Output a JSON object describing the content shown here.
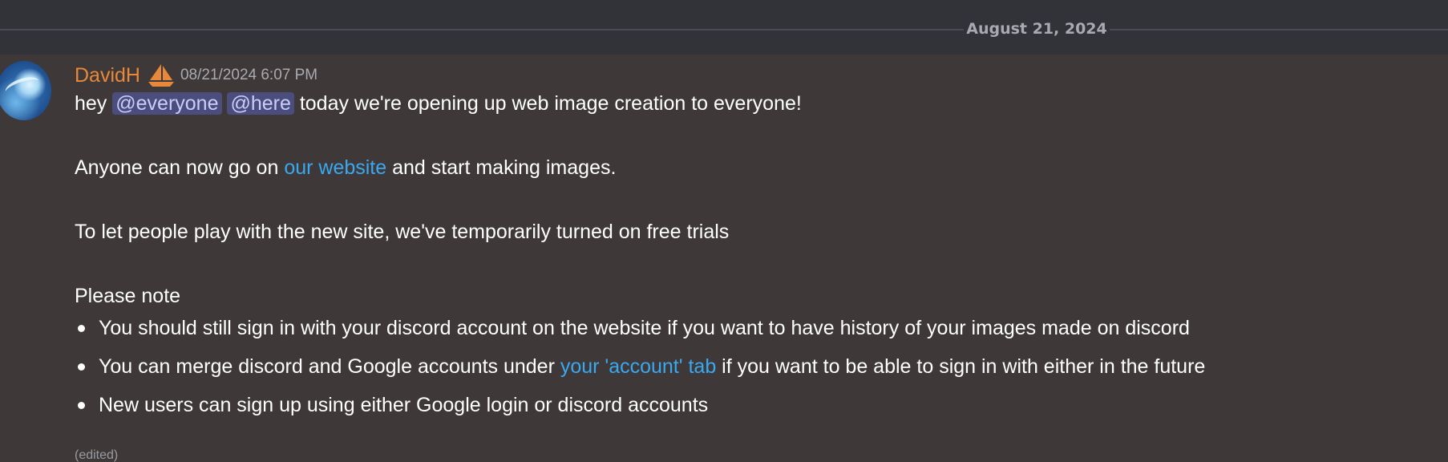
{
  "date_divider": "August 21, 2024",
  "message": {
    "username": "DavidH",
    "timestamp": "08/21/2024 6:07 PM",
    "badge_icon": "sailboat-icon",
    "line1": {
      "prefix": "hey ",
      "mention1": "@everyone",
      "mention2": "@here",
      "suffix": " today we're opening up web image creation to everyone!"
    },
    "line2": {
      "prefix": "Anyone can now go on ",
      "link": "our website",
      "suffix": " and start making images."
    },
    "line3": "To let people play with the new site, we've temporarily turned on free trials",
    "note_heading": "Please note",
    "bullets": {
      "b1": "You should still sign in with your discord account on the website if you want to have history of your images made on discord",
      "b2_prefix": "You can merge discord and Google accounts under ",
      "b2_link": "your 'account' tab",
      "b2_suffix": " if you want to be able to sign in with either in the future",
      "b3": "New users can sign up using either Google login or discord accounts"
    },
    "edited": "(edited)"
  },
  "colors": {
    "background": "#3e3938",
    "username": "#e8883b",
    "link": "#3aa8f0",
    "mention_bg": "#4b4e7d"
  }
}
